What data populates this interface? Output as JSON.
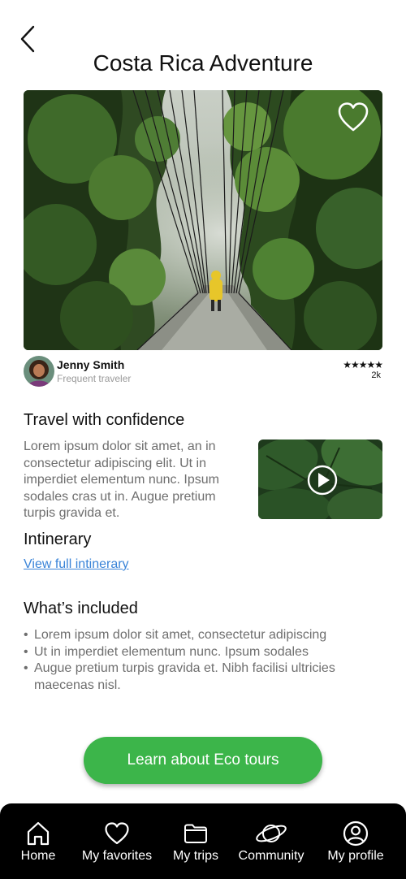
{
  "header": {
    "title": "Costa Rica Adventure"
  },
  "hero": {
    "image": "rainforest-suspension-bridge",
    "favorited": false
  },
  "author": {
    "name": "Jenny Smith",
    "subtitle": "Frequent traveler",
    "stars": "★★★★★",
    "rating_count": "2k"
  },
  "confidence": {
    "heading": "Travel with confidence",
    "text": "Lorem ipsum dolor sit amet, an in consectetur adipiscing elit. Ut in imperdiet elementum nunc. Ipsum sodales cras ut in. Augue pretium turpis gravida et."
  },
  "itinerary": {
    "heading": "Intinerary",
    "link_label": "View full intinerary"
  },
  "included": {
    "heading": "What’s included",
    "bullet": "•",
    "items": [
      "Lorem ipsum dolor sit amet, consectetur adipiscing",
      "Ut in imperdiet elementum nunc. Ipsum sodales",
      "Augue pretium turpis gravida et. Nibh facilisi ultricies maecenas nisl."
    ]
  },
  "cta": {
    "label": "Learn about Eco tours",
    "color": "#3cb54a"
  },
  "tabbar": {
    "tabs": [
      {
        "label": "Home",
        "icon": "home-icon"
      },
      {
        "label": "My favorites",
        "icon": "heart-icon"
      },
      {
        "label": "My trips",
        "icon": "folder-icon"
      },
      {
        "label": "Community",
        "icon": "planet-icon"
      },
      {
        "label": "My profile",
        "icon": "profile-icon"
      }
    ]
  }
}
